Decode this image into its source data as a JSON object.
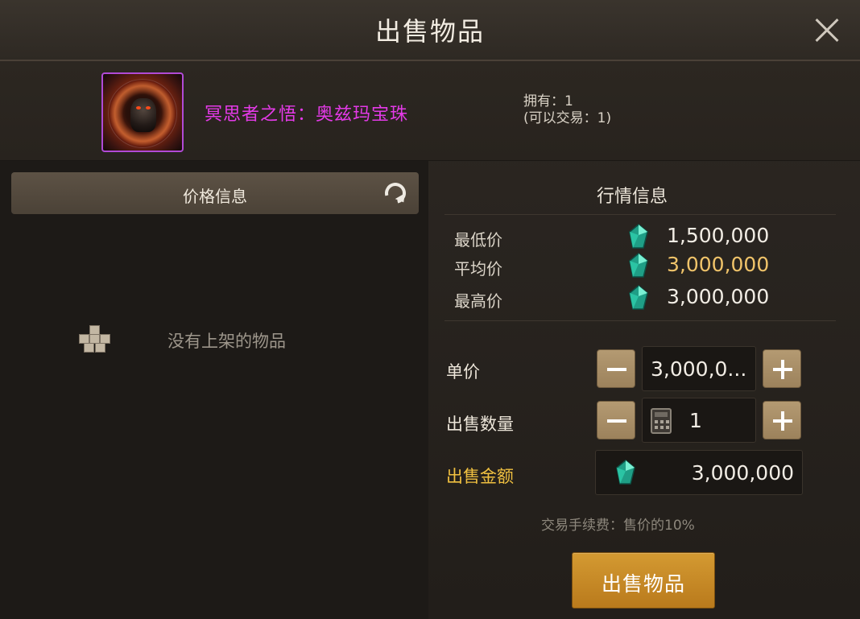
{
  "window": {
    "title": "出售物品"
  },
  "item": {
    "name": "冥思者之悟：奥兹玛宝珠",
    "owned": "拥有：1",
    "tradable": "(可以交易：1)",
    "rarity_color": "#e43ae8"
  },
  "price_info": {
    "tab_label": "价格信息",
    "empty_message": "没有上架的物品"
  },
  "market": {
    "title": "行情信息",
    "rows": [
      {
        "label": "最低价",
        "value": "1,500,000",
        "highlight": false
      },
      {
        "label": "平均价",
        "value": "3,000,000",
        "highlight": true
      },
      {
        "label": "最高价",
        "value": "3,000,000",
        "highlight": false
      }
    ]
  },
  "sell_form": {
    "unit_price_label": "单价",
    "unit_price_value": "3,000,0...",
    "quantity_label": "出售数量",
    "quantity_value": "1",
    "total_label": "出售金额",
    "total_value": "3,000,000",
    "fee_text": "交易手续费：售价的10%",
    "submit_label": "出售物品"
  },
  "colors": {
    "accent_gold": "#f0c040",
    "button_gold": "#c98a24",
    "gem_green": "#3fd6b0"
  },
  "icons": [
    "close-icon",
    "refresh-icon",
    "box-icon",
    "gem-icon",
    "calculator-icon",
    "minus-icon",
    "plus-icon"
  ]
}
